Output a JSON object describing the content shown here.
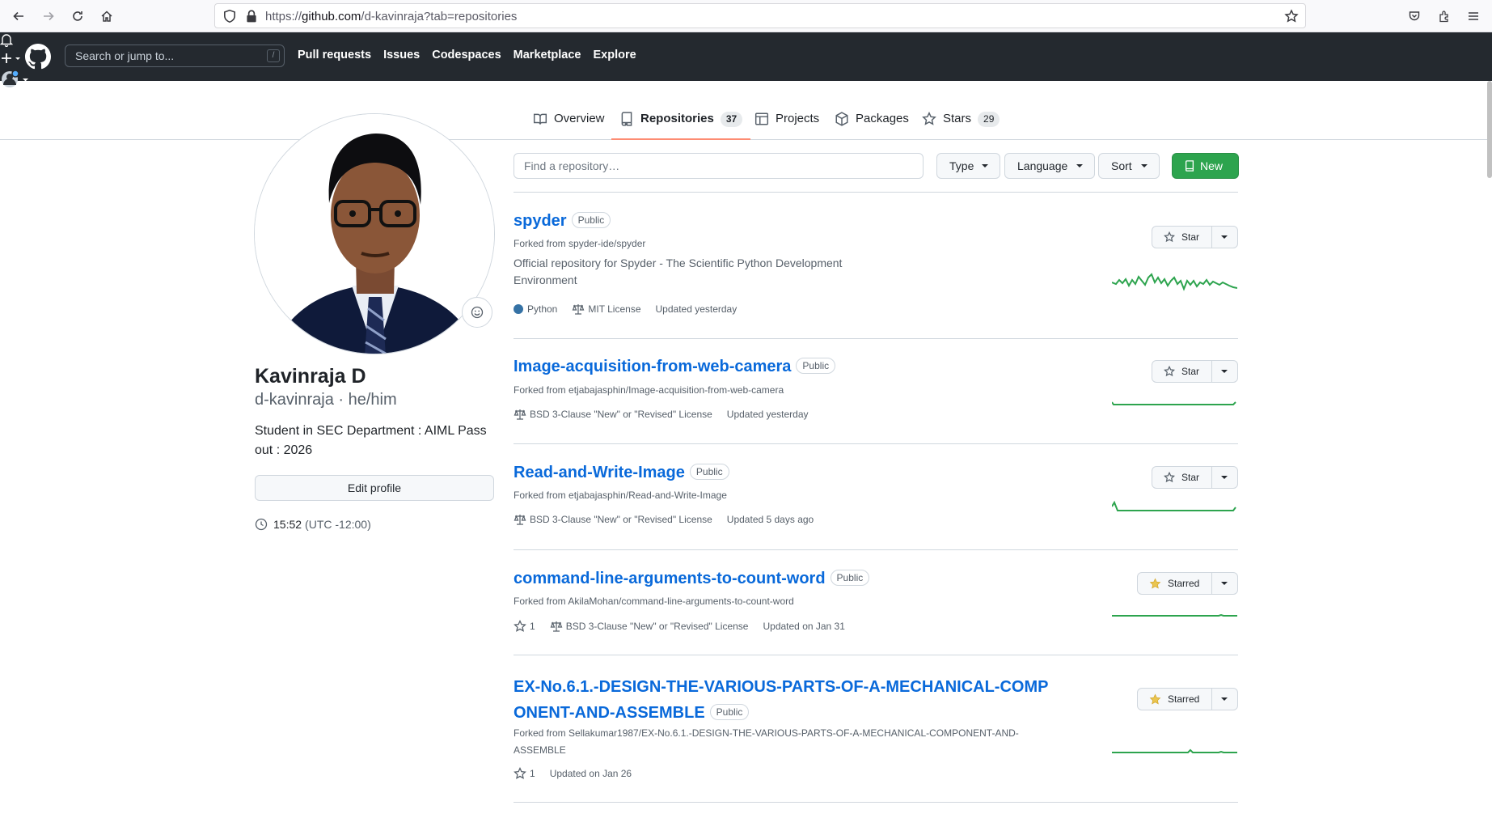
{
  "browser": {
    "url_prefix": "https://",
    "url_host": "github.com",
    "url_path": "/d-kavinraja?tab=repositories"
  },
  "header": {
    "search_placeholder": "Search or jump to...",
    "search_shortcut": "/",
    "nav": [
      "Pull requests",
      "Issues",
      "Codespaces",
      "Marketplace",
      "Explore"
    ]
  },
  "tabs": [
    {
      "label": "Overview",
      "count": "",
      "icon": "book-icon"
    },
    {
      "label": "Repositories",
      "count": "37",
      "icon": "repo-icon",
      "selected": true
    },
    {
      "label": "Projects",
      "count": "",
      "icon": "table-icon"
    },
    {
      "label": "Packages",
      "count": "",
      "icon": "package-icon"
    },
    {
      "label": "Stars",
      "count": "29",
      "icon": "star-icon"
    }
  ],
  "profile": {
    "name": "Kavinraja D",
    "handle": "d-kavinraja · he/him",
    "bio": "Student in SEC Department : AIML Pass out : 2026",
    "edit_label": "Edit profile",
    "time": "15:52",
    "tz": "(UTC -12:00)"
  },
  "filters": {
    "find_placeholder": "Find a repository…",
    "type": "Type",
    "language": "Language",
    "sort": "Sort",
    "new": "New"
  },
  "repos": [
    {
      "name": "spyder",
      "visibility": "Public",
      "forked_from": "Forked from spyder-ide/spyder",
      "description": "Official repository for Spyder - The Scientific Python Development Environment",
      "language": "Python",
      "license": "MIT License",
      "stars": "",
      "updated": "Updated yesterday",
      "star_label": "Star",
      "starred": false
    },
    {
      "name": "Image-acquisition-from-web-camera",
      "visibility": "Public",
      "forked_from": "Forked from etjabajasphin/Image-acquisition-from-web-camera",
      "description": "",
      "language": "",
      "license": "BSD 3-Clause \"New\" or \"Revised\" License",
      "stars": "",
      "updated": "Updated yesterday",
      "star_label": "Star",
      "starred": false
    },
    {
      "name": "Read-and-Write-Image",
      "visibility": "Public",
      "forked_from": "Forked from etjabajasphin/Read-and-Write-Image",
      "description": "",
      "language": "",
      "license": "BSD 3-Clause \"New\" or \"Revised\" License",
      "stars": "",
      "updated": "Updated 5 days ago",
      "star_label": "Star",
      "starred": false
    },
    {
      "name": "command-line-arguments-to-count-word",
      "visibility": "Public",
      "forked_from": "Forked from AkilaMohan/command-line-arguments-to-count-word",
      "description": "",
      "language": "",
      "license": "BSD 3-Clause \"New\" or \"Revised\" License",
      "stars": "1",
      "updated": "Updated on Jan 31",
      "star_label": "Starred",
      "starred": true
    },
    {
      "name_line1": "EX-No.6.1.-DESIGN-THE-VARIOUS-PARTS-OF-A-MECHANICAL-COMP",
      "name_line2": "ONENT-AND-ASSEMBLE",
      "visibility": "Public",
      "forked_line1": "Forked from Sellakumar1987/EX-No.6.1.-DESIGN-THE-VARIOUS-PARTS-OF-A-MECHANICAL-COMPONENT-AND-",
      "forked_line2": "ASSEMBLE",
      "stars": "1",
      "updated": "Updated on Jan 26",
      "star_label": "Starred",
      "starred": true
    }
  ],
  "colors": {
    "header_bg": "#24292f",
    "link": "#0969da",
    "new_button": "#2da44e",
    "tab_underline": "#fd8c73",
    "spark_line": "#2da44e",
    "python": "#3572A5",
    "starred_star": "#eac54f"
  }
}
